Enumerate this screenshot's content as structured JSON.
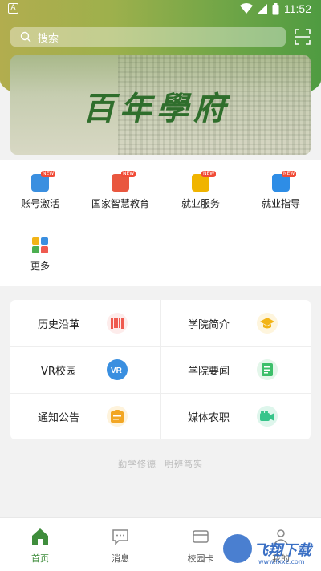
{
  "status": {
    "indicator": "A",
    "time": "11:52"
  },
  "search": {
    "placeholder": "搜索"
  },
  "banner": {
    "title": "百年學府"
  },
  "quick_links": [
    {
      "label": "账号激活",
      "icon": "account-activate-icon",
      "badge": "NEW",
      "color": "#3a8fe0"
    },
    {
      "label": "国家智慧教育",
      "icon": "smart-education-icon",
      "badge": "NEW",
      "color": "#e9573f"
    },
    {
      "label": "就业服务",
      "icon": "employment-service-icon",
      "badge": "NEW",
      "color": "#f0b400"
    },
    {
      "label": "就业指导",
      "icon": "employment-guide-icon",
      "badge": "NEW",
      "color": "#2e8de6"
    },
    {
      "label": "更多",
      "icon": "more-grid-icon",
      "badge": "",
      "color": "#4caf50"
    }
  ],
  "feature_cards": [
    {
      "label": "历史沿革",
      "icon": "history-icon",
      "color": "#ef5a4f"
    },
    {
      "label": "学院简介",
      "icon": "graduation-cap-icon",
      "color": "#f2b417"
    },
    {
      "label": "VR校园",
      "icon": "vr-icon",
      "color": "#3a8fe0"
    },
    {
      "label": "学院要闻",
      "icon": "news-icon",
      "color": "#3cbf6a"
    },
    {
      "label": "通知公告",
      "icon": "notice-icon",
      "color": "#f2a623"
    },
    {
      "label": "媒体农职",
      "icon": "video-camera-icon",
      "color": "#36c48a"
    }
  ],
  "motto": [
    "勤学修德",
    "明辨笃实"
  ],
  "tabs": [
    {
      "label": "首页",
      "icon": "home-icon",
      "active": true
    },
    {
      "label": "消息",
      "icon": "message-icon",
      "active": false
    },
    {
      "label": "校园卡",
      "icon": "campus-card-icon",
      "active": false
    },
    {
      "label": "我的",
      "icon": "profile-icon",
      "active": false
    }
  ],
  "watermark": {
    "text": "飞翔下载",
    "url": "www.fxxz.com"
  }
}
